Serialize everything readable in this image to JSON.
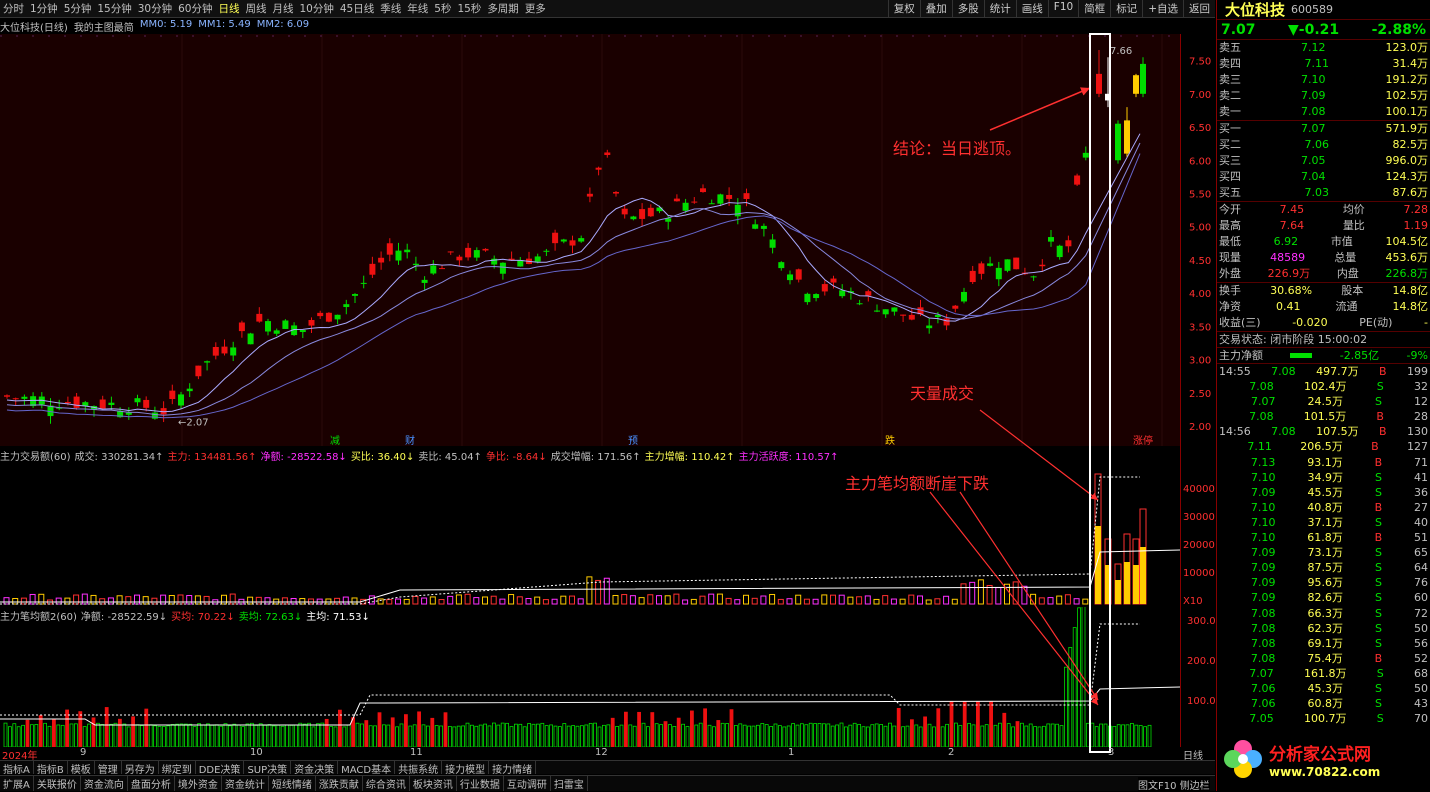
{
  "toolbar": {
    "periods": [
      "分时",
      "1分钟",
      "5分钟",
      "15分钟",
      "30分钟",
      "60分钟",
      "日线",
      "周线",
      "月线",
      "10分钟",
      "45日线",
      "季线",
      "年线",
      "5秒",
      "15秒",
      "多周期",
      "更多"
    ],
    "active": "日线",
    "right": [
      "复权",
      "叠加",
      "多股",
      "统计",
      "画线",
      "F10",
      "简框",
      "标记",
      "+自选",
      "返回"
    ]
  },
  "chart_header": {
    "name": "大位科技(日线)",
    "formula": "我的主图最简",
    "ma0": "MM0: 5.19",
    "ma1": "MM1: 5.49",
    "ma2": "MM2: 6.09"
  },
  "price_axis": [
    "7.50",
    "7.00",
    "6.50",
    "6.00",
    "5.50",
    "5.00",
    "4.50",
    "4.00",
    "3.50",
    "3.00",
    "2.50",
    "2.00"
  ],
  "ind1_axis": [
    "40000",
    "30000",
    "20000",
    "10000",
    "X10"
  ],
  "ind2_axis": [
    "300.0",
    "200.0",
    "100.0"
  ],
  "labels": {
    "high": "7.66",
    "low": "2.07",
    "markers": [
      "减",
      "财",
      "预",
      "跌",
      "涨停"
    ],
    "month_labels": [
      "2024年",
      "9",
      "10",
      "11",
      "12",
      "1",
      "2",
      "3"
    ],
    "period": "日线"
  },
  "ind1_header": [
    "主力交易额(60)",
    "成交: 330281.34↑",
    "主力: 134481.56↑",
    "净额: -28522.58↓",
    "买比: 36.40↓",
    "卖比: 45.04↑",
    "争比: -8.64↓",
    "成交增幅: 171.56↑",
    "主力增幅: 110.42↑",
    "主力活跃度: 110.57↑"
  ],
  "ind2_header": [
    "主力笔均额2(60)",
    "净额: -28522.59↓",
    "买均: 70.22↓",
    "卖均: 72.63↓",
    "主均: 71.53↓"
  ],
  "annotations": {
    "a1": "结论：当日逃顶。",
    "a2": "天量成交",
    "a3": "主力笔均额断崖下跌"
  },
  "bottom_tabs": [
    "指标A",
    "指标B",
    "模板",
    "管理",
    "另存为",
    "绑定到",
    "DDE决策",
    "SUP决策",
    "资金决策",
    "MACD基本",
    "共振系统",
    "接力模型",
    "接力情绪"
  ],
  "bottom_tabs2": [
    "扩展A",
    "关联报价",
    "资金流向",
    "盘面分析",
    "境外资金",
    "资金统计",
    "短线情绪",
    "涨跌贡献",
    "综合资讯",
    "板块资讯",
    "行业数据",
    "互动调研",
    "扫雷宝"
  ],
  "bottom_right": "图文F10 侧边栏",
  "stock": {
    "name": "大位科技",
    "code": "600589",
    "price": "7.07",
    "change": "▼-0.21",
    "pct": "-2.88%"
  },
  "sells": [
    [
      "卖五",
      "7.12",
      "123.0万"
    ],
    [
      "卖四",
      "7.11",
      "31.4万"
    ],
    [
      "卖三",
      "7.10",
      "191.2万"
    ],
    [
      "卖二",
      "7.09",
      "102.5万"
    ],
    [
      "卖一",
      "7.08",
      "100.1万"
    ]
  ],
  "buys": [
    [
      "买一",
      "7.07",
      "571.9万"
    ],
    [
      "买二",
      "7.06",
      "82.5万"
    ],
    [
      "买三",
      "7.05",
      "996.0万"
    ],
    [
      "买四",
      "7.04",
      "124.3万"
    ],
    [
      "买五",
      "7.03",
      "87.6万"
    ]
  ],
  "stats": [
    [
      "今开",
      "7.45",
      "均价",
      "7.28"
    ],
    [
      "最高",
      "7.64",
      "量比",
      "1.19"
    ],
    [
      "最低",
      "6.92",
      "市值",
      "104.5亿"
    ],
    [
      "现量",
      "48589",
      "总量",
      "453.6万"
    ],
    [
      "外盘",
      "226.9万",
      "内盘",
      "226.8万"
    ]
  ],
  "stats2": [
    [
      "换手",
      "30.68%",
      "股本",
      "14.8亿"
    ],
    [
      "净资",
      "0.41",
      "流通",
      "14.8亿"
    ],
    [
      "收益(三)",
      "-0.020",
      "PE(动)",
      "-"
    ]
  ],
  "trade_state": "交易状态: 闭市阶段 15:00:02",
  "main_flow": {
    "label": "主力净额",
    "value": "-2.85亿",
    "pct": "-9%"
  },
  "ticks": [
    [
      "14:55",
      "7.08",
      "497.7万",
      "B",
      "199"
    ],
    [
      "",
      "7.08",
      "102.4万",
      "S",
      "32"
    ],
    [
      "",
      "7.07",
      "24.5万",
      "S",
      "12"
    ],
    [
      "",
      "7.08",
      "101.5万",
      "B",
      "28"
    ],
    [
      "14:56",
      "7.08",
      "107.5万",
      "B",
      "130"
    ],
    [
      "",
      "7.11",
      "206.5万",
      "B",
      "127"
    ],
    [
      "",
      "7.13",
      "93.1万",
      "B",
      "71"
    ],
    [
      "",
      "7.10",
      "34.9万",
      "S",
      "41"
    ],
    [
      "",
      "7.09",
      "45.5万",
      "S",
      "36"
    ],
    [
      "",
      "7.10",
      "40.8万",
      "B",
      "27"
    ],
    [
      "",
      "7.10",
      "37.1万",
      "S",
      "40"
    ],
    [
      "",
      "7.10",
      "61.8万",
      "B",
      "51"
    ],
    [
      "",
      "7.09",
      "73.1万",
      "S",
      "65"
    ],
    [
      "",
      "7.09",
      "87.5万",
      "S",
      "64"
    ],
    [
      "",
      "7.09",
      "95.6万",
      "S",
      "76"
    ],
    [
      "",
      "7.09",
      "82.6万",
      "S",
      "60"
    ],
    [
      "",
      "7.08",
      "66.3万",
      "S",
      "72"
    ],
    [
      "",
      "7.08",
      "62.3万",
      "S",
      "50"
    ],
    [
      "",
      "7.08",
      "69.1万",
      "S",
      "56"
    ],
    [
      "",
      "7.08",
      "75.4万",
      "B",
      "52"
    ],
    [
      "",
      "7.07",
      "161.8万",
      "S",
      "68"
    ],
    [
      "",
      "7.06",
      "45.3万",
      "S",
      "50"
    ],
    [
      "",
      "7.06",
      "60.8万",
      "S",
      "43"
    ],
    [
      "",
      "7.05",
      "100.7万",
      "S",
      "70"
    ]
  ],
  "logo": {
    "text": "分析家公式网",
    "url": "www.70822.com"
  }
}
